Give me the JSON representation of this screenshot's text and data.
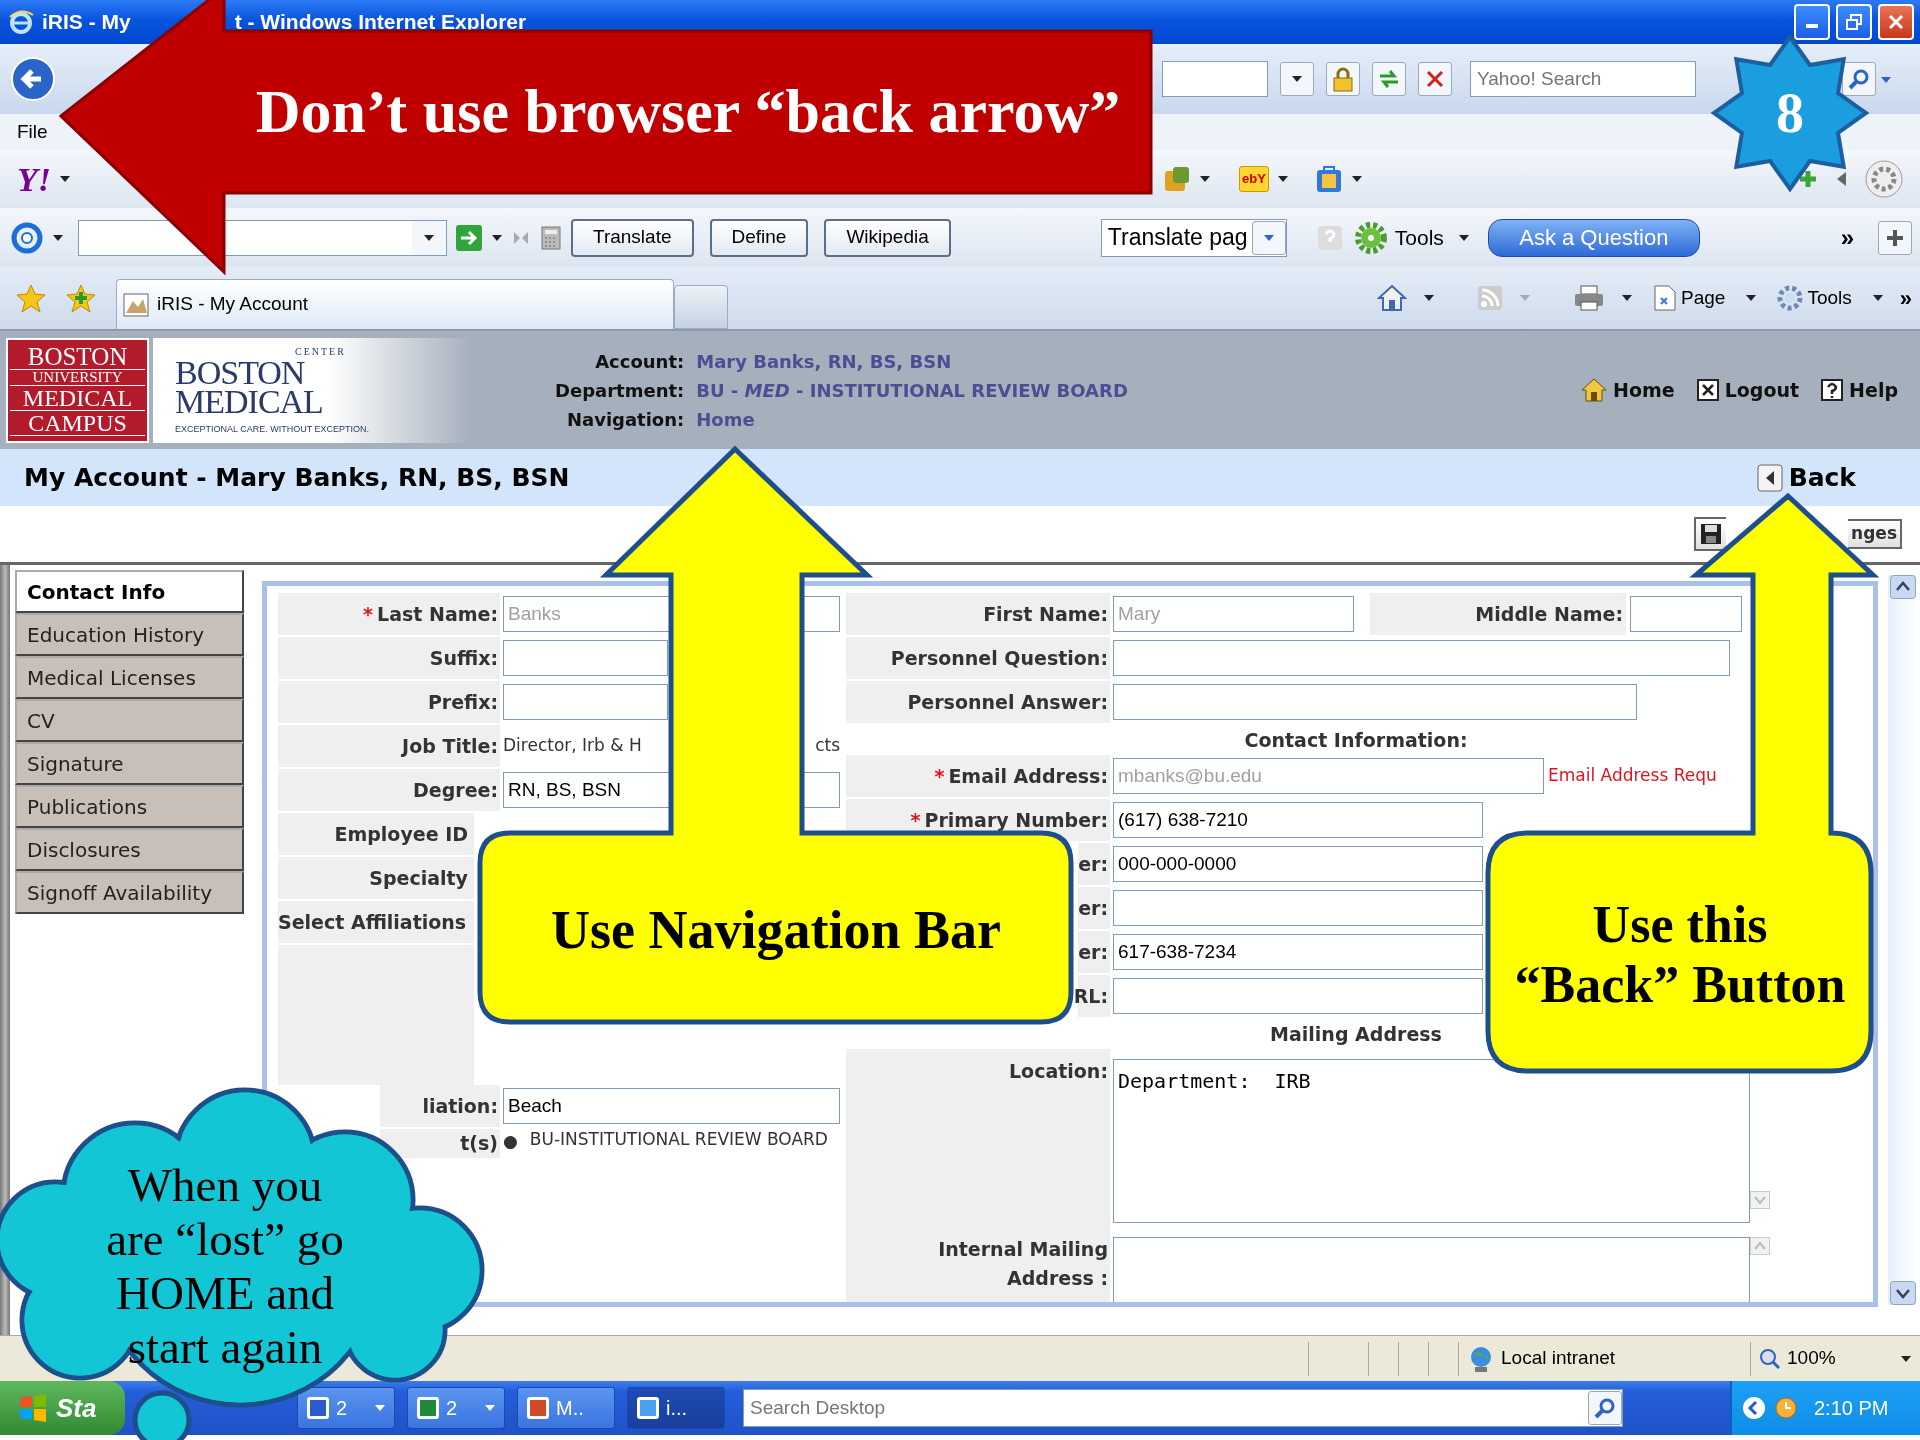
{
  "window": {
    "title_start": "iRIS - My",
    "title_end": "t - Windows Internet Explorer"
  },
  "address_bar": {
    "search_placeholder": "Yahoo! Search"
  },
  "menu": [
    "File"
  ],
  "yahoo_bar": {
    "logo": "Y!",
    "shop_icon": "ebY"
  },
  "links_bar": {
    "buttons": [
      "Translate",
      "Define",
      "Wikipedia"
    ],
    "translate_select": "Translate pag",
    "tools": "Tools",
    "ask": "Ask a Question",
    "more": "»"
  },
  "tabs": [
    {
      "label": "iRIS - My Account",
      "selected": true
    }
  ],
  "command_bar": {
    "page": "Page",
    "tools": "Tools",
    "more": "»"
  },
  "header": {
    "bu_logo": [
      "BOSTON",
      "UNIVERSITY",
      "MEDICAL",
      "CAMPUS"
    ],
    "bmc_logo": {
      "arc": "CENTER",
      "lines": [
        "BOSTON",
        "MEDICAL"
      ],
      "tagline": "EXCEPTIONAL CARE. WITHOUT EXCEPTION."
    },
    "info": [
      {
        "label": "Account:",
        "value": "Mary Banks, RN, BS, BSN"
      },
      {
        "label": "Department:",
        "value": "BU - *MED* - INSTITUTIONAL REVIEW BOARD"
      },
      {
        "label": "Navigation:",
        "value": "Home"
      }
    ],
    "links": [
      {
        "kind": "home",
        "label": "Home"
      },
      {
        "kind": "logout",
        "label": "Logout"
      },
      {
        "kind": "help",
        "label": "Help"
      }
    ]
  },
  "page_title": "My Account - Mary Banks, RN, BS, BSN",
  "back_button": "Back",
  "save_button": "nges",
  "side_tabs": [
    {
      "label": "Contact Info",
      "selected": true
    },
    {
      "label": "Education History",
      "selected": false
    },
    {
      "label": "Medical Licenses",
      "selected": false
    },
    {
      "label": "CV",
      "selected": false
    },
    {
      "label": "Signature",
      "selected": false
    },
    {
      "label": "Publications",
      "selected": false
    },
    {
      "label": "Disclosures",
      "selected": false
    },
    {
      "label": "Signoff Availability",
      "selected": false
    }
  ],
  "form": {
    "left_rows": [
      {
        "kind": "input",
        "required_mark": "*",
        "label": "Last Name:",
        "value": "Banks",
        "disabled": true
      },
      {
        "kind": "input",
        "label": "Suffix:"
      },
      {
        "kind": "input",
        "label": "Prefix:"
      },
      {
        "kind": "text",
        "label": "Job Title:",
        "value_start": "Director, Irb & H",
        "value_end": "cts"
      },
      {
        "kind": "input",
        "label": "Degree:",
        "value": "RN, BS, BSN"
      },
      {
        "kind": "covered",
        "label": "Employee ID"
      },
      {
        "kind": "covered",
        "label": "Specialty"
      },
      {
        "kind": "heading",
        "label": "Select Affiliations"
      }
    ],
    "lower_rows": [
      {
        "kind": "input",
        "label": "liation:",
        "value": "Beach"
      },
      {
        "kind": "list",
        "label": "t(s)",
        "bullet": "●",
        "value": "BU-INSTITUTIONAL REVIEW BOARD"
      }
    ],
    "right_rows": [
      {
        "kind": "pair",
        "label": "First Name:",
        "value": "Mary",
        "disabled": true,
        "label2": "Middle Name:"
      },
      {
        "kind": "input",
        "label": "Personnel Question:"
      },
      {
        "kind": "input",
        "label": "Personnel Answer:"
      },
      {
        "kind": "heading",
        "label": "Contact Information:"
      },
      {
        "kind": "input",
        "required_mark": "*",
        "label": "Email Address:",
        "value": "mbanks@bu.edu",
        "disabled": true,
        "error": "Email Address Requ"
      },
      {
        "kind": "input",
        "required_mark": "*",
        "label": "Primary Number:",
        "value": "(617) 638-7210"
      },
      {
        "kind": "clipped",
        "label": "er:",
        "value": "000-000-0000"
      },
      {
        "kind": "clipped",
        "label": "er:"
      },
      {
        "kind": "clipped",
        "label": "er:",
        "value": "617-638-7234"
      },
      {
        "kind": "clipped",
        "label": "RL:"
      },
      {
        "kind": "heading",
        "label": "Mailing Address"
      },
      {
        "kind": "textarea",
        "label": "Location:",
        "value": "Department:  IRB"
      },
      {
        "kind": "textarea",
        "label": "Internal Mailing Address :"
      }
    ]
  },
  "status_bar": {
    "zone": "Local intranet",
    "zoom": "100%"
  },
  "taskbar": {
    "start": "Sta",
    "buttons": [
      {
        "kind": "word",
        "label": "2",
        "caret": true,
        "selected": false
      },
      {
        "kind": "excel",
        "label": "2",
        "caret": true,
        "selected": false
      },
      {
        "kind": "app",
        "label": "M..",
        "caret": false,
        "selected": false
      },
      {
        "kind": "browser",
        "label": "i...",
        "caret": false,
        "selected": true
      }
    ],
    "search_placeholder": "Search Desktop",
    "clock": "2:10 PM"
  },
  "callouts": {
    "browser_arrow": "Don’t use browser “back arrow”",
    "slide_number": "8",
    "nav_arrow": "Use Navigation Bar",
    "back_arrow": "Use this\n“Back” Button",
    "cloud": "When you\nare “lost” go\nHOME and\nstart again"
  }
}
